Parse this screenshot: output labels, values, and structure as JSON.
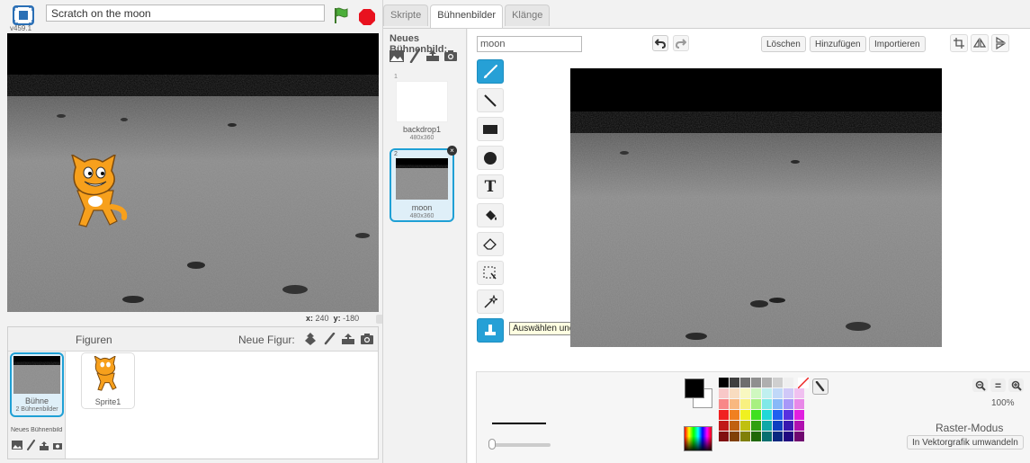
{
  "project": {
    "title": "Scratch on the moon",
    "version": "v459.1"
  },
  "stage": {
    "coords_x_label": "x:",
    "coords_x": "240",
    "coords_y_label": "y:",
    "coords_y": "-180"
  },
  "sprites_panel": {
    "figuren_label": "Figuren",
    "neue_figur_label": "Neue Figur:",
    "stage_thumb_label": "Bühne",
    "stage_thumb_sub": "2 Bühnenbilder",
    "neues_buehnenbild_label": "Neues Bühnenbild",
    "sprites": [
      {
        "name": "Sprite1"
      }
    ]
  },
  "tabs": [
    {
      "label": "Skripte",
      "active": false
    },
    {
      "label": "Bühnenbilder",
      "active": true
    },
    {
      "label": "Klänge",
      "active": false
    }
  ],
  "backdrops": {
    "new_label": "Neues Bühnenbild:",
    "items": [
      {
        "number": "1",
        "name": "backdrop1",
        "size": "480x360"
      },
      {
        "number": "2",
        "name": "moon",
        "size": "480x360"
      }
    ]
  },
  "editor": {
    "costume_name": "moon",
    "buttons": {
      "delete": "Löschen",
      "add": "Hinzufügen",
      "import": "Importieren"
    },
    "tools": [
      {
        "name": "brush-tool",
        "active": true
      },
      {
        "name": "line-tool",
        "active": false
      },
      {
        "name": "rectangle-tool",
        "active": false
      },
      {
        "name": "ellipse-tool",
        "active": false
      },
      {
        "name": "text-tool",
        "active": false
      },
      {
        "name": "fill-tool",
        "active": false
      },
      {
        "name": "eraser-tool",
        "active": false
      },
      {
        "name": "select-tool",
        "active": false
      },
      {
        "name": "magic-wand-tool",
        "active": false
      },
      {
        "name": "stamp-tool",
        "active": true
      }
    ],
    "tooltip": "Auswählen und Duplizieren",
    "zoom_percent": "100%",
    "mode_label": "Raster-Modus",
    "convert_label": "In Vektorgrafik umwandeln"
  },
  "colors": {
    "accent": "#26a0d6",
    "flag": "#3d9a3d",
    "stop": "#e32",
    "palette": [
      "#000000",
      "#3f3f3f",
      "#6e6e6e",
      "#8f8f8f",
      "#afafaf",
      "#cfcfcf",
      "#efefef",
      "#ffffff",
      "#f8c8c8",
      "#f8dcc0",
      "#f8f8c0",
      "#cff8c0",
      "#c0f0f0",
      "#c0d8f8",
      "#d0c8f8",
      "#f0c0f0",
      "#f88888",
      "#f8b880",
      "#f8f080",
      "#a8f080",
      "#80e8e8",
      "#88b8f8",
      "#a898f8",
      "#e888e8",
      "#f02020",
      "#f08020",
      "#f0f020",
      "#40e020",
      "#20d8d8",
      "#2060f0",
      "#5830e0",
      "#e020e0",
      "#c01818",
      "#c06010",
      "#c0c010",
      "#30a010",
      "#10a8a8",
      "#1040c0",
      "#3818b0",
      "#b010b0",
      "#801010",
      "#804008",
      "#808008",
      "#206808",
      "#087070",
      "#082880",
      "#200880",
      "#700870"
    ]
  }
}
